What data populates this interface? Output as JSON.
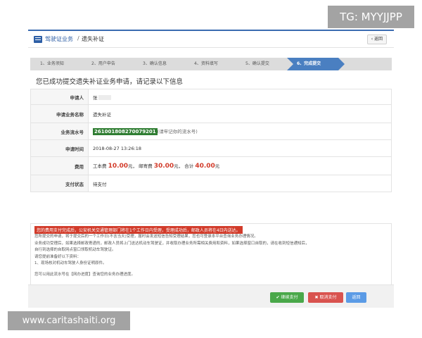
{
  "watermarks": {
    "top_right": "TG: MYYJJPP",
    "bottom_left": "www.caritashaiti.org"
  },
  "header": {
    "crumb_main": "驾驶证业务",
    "separator": "/",
    "crumb_sub": "遗失补证",
    "back_label": "‹ 返回"
  },
  "steps": [
    {
      "label": "1、业务须知"
    },
    {
      "label": "2、用户申告"
    },
    {
      "label": "3、确认信息"
    },
    {
      "label": "4、资料填写"
    },
    {
      "label": "5、确认提交"
    },
    {
      "label": "6、完成提交"
    }
  ],
  "success_title": "您已成功提交遗失补证业务申请，请记录以下信息",
  "info": {
    "applicant_label": "申请人",
    "applicant_value": "张",
    "business_label": "申请业务名称",
    "business_value": "遗失补证",
    "flow_label": "业务流水号",
    "flow_value": "261001808270079201",
    "flow_hint": "(请牢记你的流水号)",
    "time_label": "申请时间",
    "time_value": "2018-08-27 13:26:18",
    "fee_label": "费用",
    "fee_cost_prefix": "工本费",
    "fee_cost": "10.00",
    "fee_cost_unit": "元，",
    "fee_post_prefix": "邮寄费",
    "fee_post": "30.00",
    "fee_post_unit": "元，",
    "fee_total_prefix": "合计",
    "fee_total": "40.00",
    "fee_total_unit": "元",
    "pay_label": "支付状态",
    "pay_value": "待支付"
  },
  "notice": {
    "alert": "您的费用支付完成后，公安机关交通管理部门将在1个工作日内受理，受理成功后，邮政人员将在4日内送达。",
    "line1": "您所提交的申请，将于提交后的一个工作日(不含当天)受理，届时会发送短信告知受理结果，您也可登录本平台查询业务办理情况。",
    "line2": "业务成功受理后，如果选择邮政寄递的，邮政人员将上门送达机动车驾驶证，并收取办理业务所需相关费用和资料，如果选择窗口自取的，请在收到短信通知后，",
    "line3": "自行到选择的自取网点窗口领取机动车驾驶证。",
    "line4": "请您提前准备好以下资料：",
    "line5": "1、现场核对机动车驾驶人身份证明原件。",
    "line6": "您可以用此流水号在【网办进度】查询您的业务办理进度。"
  },
  "buttons": {
    "continue": "✔ 继续支付",
    "cancel": "✖ 取消支付",
    "return": "返回"
  },
  "colors": {
    "brand_blue": "#4a7fc1",
    "flow_green": "#2f7d32",
    "fee_red": "#d23b2a"
  }
}
